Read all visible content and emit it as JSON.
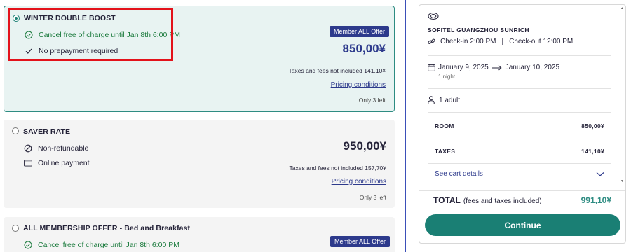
{
  "rates": [
    {
      "title": "WINTER DOUBLE BOOST",
      "selected": true,
      "features": [
        {
          "icon": "check-circle-icon",
          "text": "Cancel free of charge until Jan 8th 6:00 PM",
          "color": "#1a7a3c"
        },
        {
          "icon": "check-icon",
          "text": "No prepayment required",
          "color": "#252339"
        }
      ],
      "badge": "Member ALL Offer",
      "price": "850,00¥",
      "taxes": "Taxes and fees not included 141,10¥",
      "pricing_link": "Pricing conditions",
      "availability": "Only 3 left"
    },
    {
      "title": "SAVER RATE",
      "selected": false,
      "features": [
        {
          "icon": "no-entry-icon",
          "text": "Non-refundable"
        },
        {
          "icon": "credit-card-icon",
          "text": "Online payment"
        }
      ],
      "price": "950,00¥",
      "taxes": "Taxes and fees not included 157,70¥",
      "pricing_link": "Pricing conditions",
      "availability": "Only 3 left"
    },
    {
      "title": "ALL MEMBERSHIP OFFER - Bed and Breakfast",
      "selected": false,
      "features": [
        {
          "icon": "check-circle-icon",
          "text": "Cancel free of charge until Jan 8th 6:00 PM",
          "color": "#1a7a3c"
        }
      ],
      "badge": "Member ALL Offer"
    }
  ],
  "summary": {
    "hotel_logo_icon": "sofitel-logo-icon",
    "hotel_name": "SOFITEL GUANGZHOU SUNRICH",
    "check_in": "Check-in 2:00 PM",
    "check_out": "Check-out 12:00 PM",
    "date_from": "January 9, 2025",
    "date_to": "January 10, 2025",
    "nights": "1 night",
    "guests": "1 adult",
    "room_label": "ROOM",
    "room_value": "850,00¥",
    "taxes_label": "TAXES",
    "taxes_value": "141,10¥",
    "cart_details": "See cart details",
    "total_label": "TOTAL",
    "total_note": "(fees and taxes included)",
    "total_value": "991,10¥",
    "continue_label": "Continue"
  },
  "colors": {
    "accent_teal": "#1a7f74",
    "badge_navy": "#2d3a8c",
    "highlight_red": "#e3121b"
  }
}
